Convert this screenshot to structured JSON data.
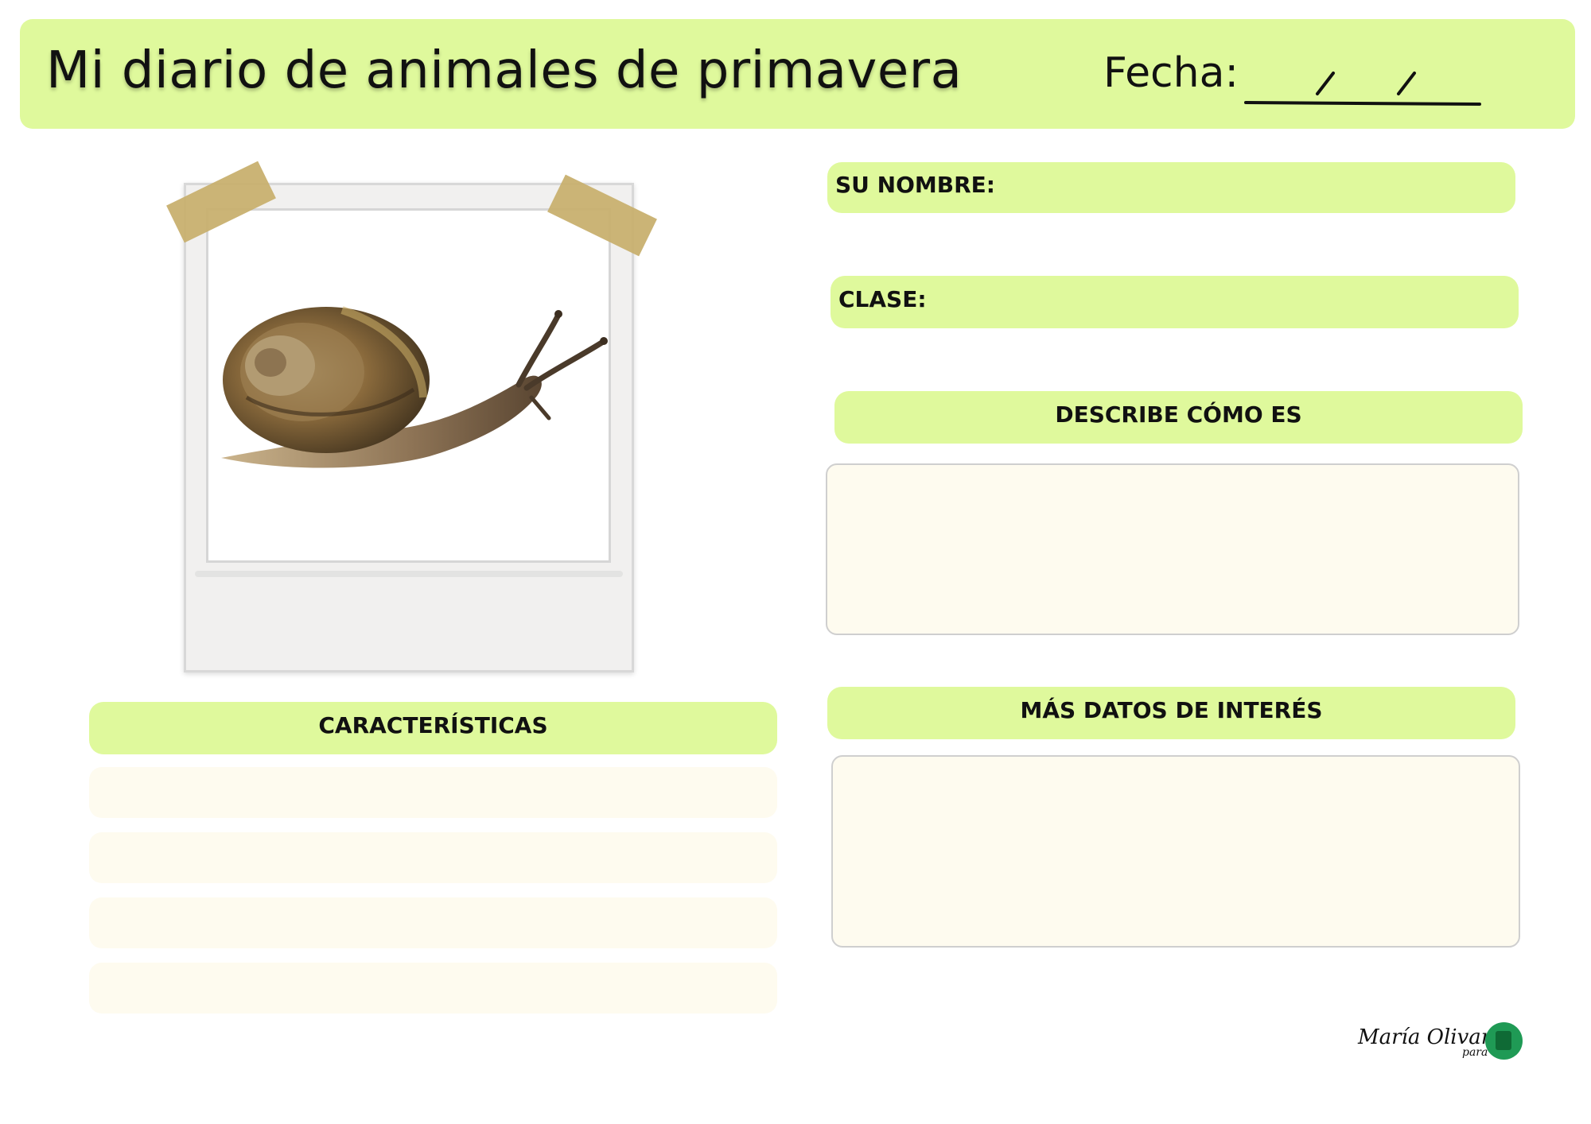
{
  "header": {
    "title": "Mi diario de animales de primavera",
    "date_label": "Fecha:",
    "date_separators": [
      "/",
      "/"
    ]
  },
  "photo": {
    "subject_icon": "snail-icon"
  },
  "fields": {
    "name_label": "SU NOMBRE:",
    "class_label": "CLASE:"
  },
  "sections": {
    "describe_title": "DESCRIBE CÓMO ES",
    "more_info_title": "MÁS DATOS DE INTERÉS",
    "features_title": "CARACTERÍSTICAS",
    "feature_lines": [
      "",
      "",
      "",
      ""
    ]
  },
  "signature": {
    "author": "María Olivares",
    "para": "para",
    "logo_icon": "brand-logo-icon"
  },
  "colors": {
    "accent_green": "#dff99c",
    "box_fill": "#fefbef",
    "tape": "#c8b06f",
    "logo_green": "#1f9a55"
  }
}
